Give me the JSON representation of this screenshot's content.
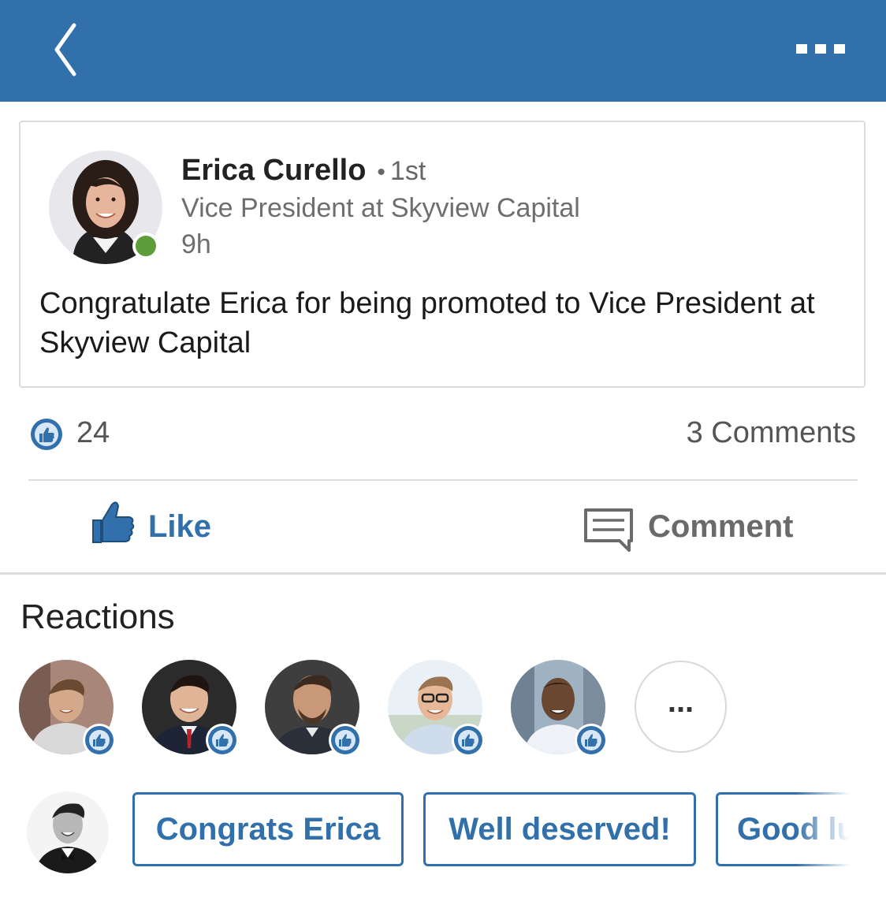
{
  "header": {
    "back_icon": "chevron-left-icon",
    "more_icon": "more-horizontal-icon",
    "background_color": "#3270ab"
  },
  "post": {
    "author_name": "Erica Curello",
    "connection_degree": "1st",
    "headline": "Vice President at Skyview Capital",
    "time_ago": "9h",
    "online_status_color": "#5d9d3a",
    "text": "Congratulate Erica for being promoted to Vice President at Skyview Capital"
  },
  "social": {
    "like_count": "24",
    "comments_count": "3 Comments"
  },
  "actions": {
    "like_label": "Like",
    "comment_label": "Comment",
    "accent_color": "#3270ab"
  },
  "reactions": {
    "title": "Reactions",
    "more_label": "..."
  },
  "quick_replies": [
    {
      "label": "Congrats Erica"
    },
    {
      "label": "Well deserved!"
    },
    {
      "label": "Good luck"
    }
  ]
}
